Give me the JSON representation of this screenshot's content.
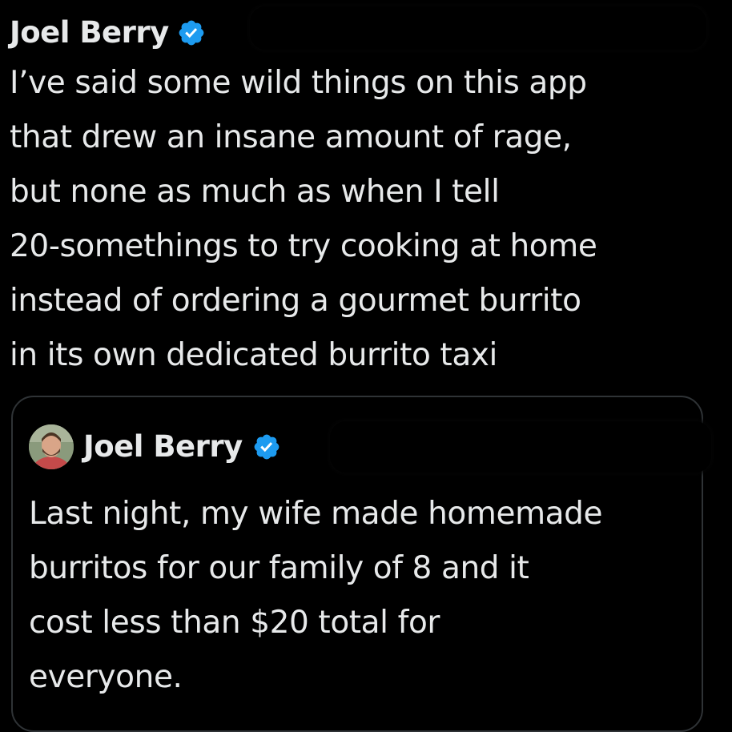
{
  "tweet": {
    "author_name": "Joel Berry",
    "verified_icon": "verified-badge-icon",
    "text": "I’ve said some wild things on this app\nthat drew an insane amount of rage,\nbut none as much as when I tell\n20-somethings to try cooking at home\ninstead of ordering a gourmet burrito\nin its own dedicated burrito taxi"
  },
  "quoted_tweet": {
    "author_name": "Joel Berry",
    "avatar_icon": "avatar",
    "verified_icon": "verified-badge-icon",
    "text": "Last night, my wife made homemade\nburritos for our family of 8 and it\ncost less than $20 total for\neveryone."
  },
  "colors": {
    "background": "#000000",
    "text": "#e7e9ea",
    "verified": "#1d9bf0",
    "card_border": "#2f3336"
  }
}
